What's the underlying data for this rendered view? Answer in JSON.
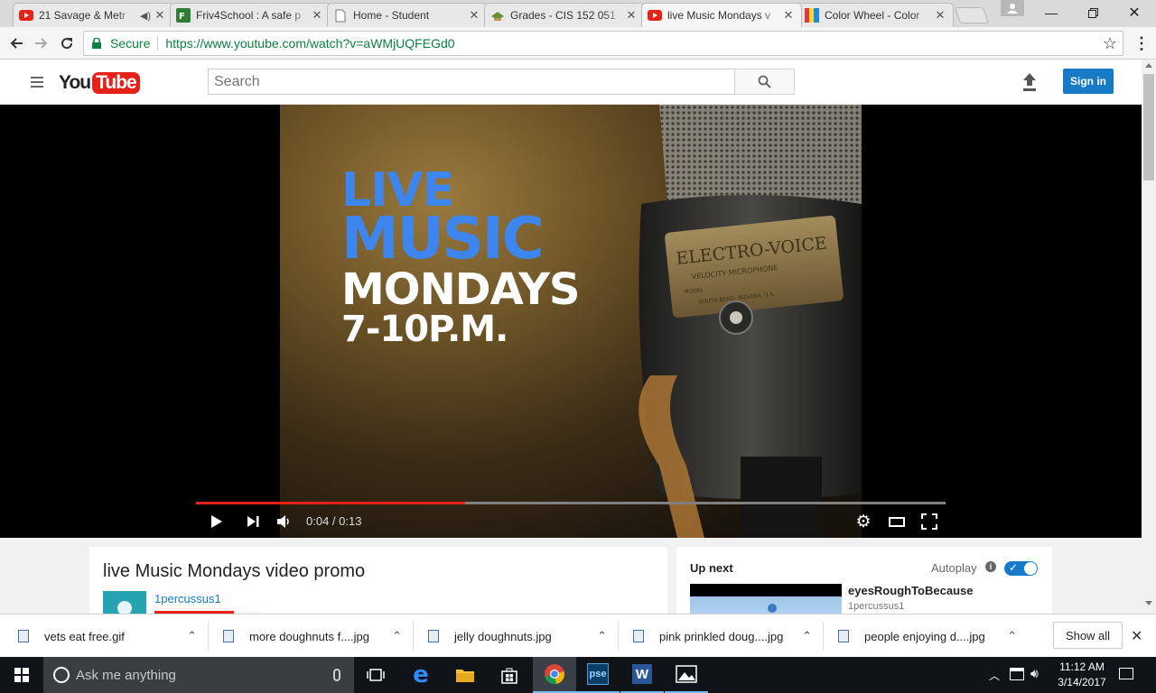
{
  "browser": {
    "tabs": [
      {
        "title": "21 Savage & Metr",
        "icon": "youtube-icon",
        "audio": true
      },
      {
        "title": "Friv4School : A safe p",
        "icon": "friv-icon"
      },
      {
        "title": "Home - Student",
        "icon": "page-icon"
      },
      {
        "title": "Grades - CIS 152 051",
        "icon": "grades-icon"
      },
      {
        "title": "live Music Mondays v",
        "icon": "youtube-icon",
        "active": true
      },
      {
        "title": "Color Wheel - Color",
        "icon": "colorwheel-icon"
      }
    ],
    "secure_label": "Secure",
    "url": "https://www.youtube.com/watch?v=aWMjUQFEGd0"
  },
  "youtube": {
    "logo_you": "You",
    "logo_tube": "Tube",
    "search_placeholder": "Search",
    "sign_in": "Sign in",
    "video_overlay": {
      "line1": "LIVE",
      "line2": "MUSIC",
      "line3": "MONDAYS",
      "line4": "7-10P.M.",
      "mic_brand": "ELECTRO-VOICE",
      "mic_sub": "VELOCITY MICROPHONE",
      "mic_model": "MODEL",
      "mic_city": "SOUTH BEND, INDIANA, U.S."
    },
    "player": {
      "time": "0:04 / 0:13",
      "progress": 0.3594,
      "colors": {
        "played": "#e62117",
        "track": "#808080"
      }
    },
    "video_title": "live Music Mondays video promo",
    "channel": "1percussus1",
    "upnext": {
      "heading": "Up next",
      "autoplay_label": "Autoplay",
      "autoplay_on": true,
      "item_title": "eyesRoughToBecause",
      "item_channel": "1percussus1"
    }
  },
  "downloads": {
    "items": [
      "vets eat free.gif",
      "more doughnuts f....jpg",
      "jelly doughnuts.jpg",
      "pink prinkled doug....jpg",
      "people enjoying d....jpg"
    ],
    "show_all": "Show all"
  },
  "taskbar": {
    "search_placeholder": "Ask me anything",
    "time": "11:12 AM",
    "date": "3/14/2017",
    "apps": [
      "task-view-icon",
      "edge-icon",
      "file-explorer-icon",
      "store-icon",
      "chrome-icon",
      "pse-icon",
      "word-icon",
      "photos-icon"
    ]
  }
}
